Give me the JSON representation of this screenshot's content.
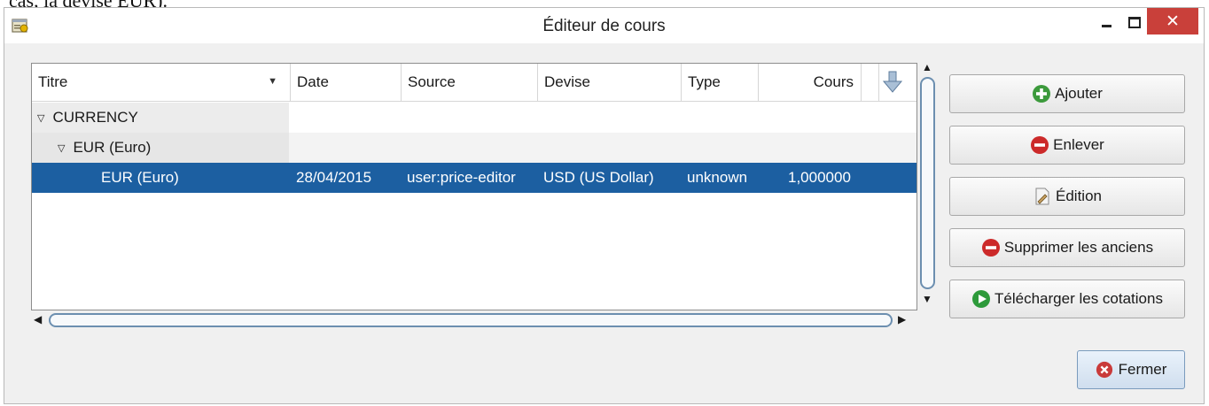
{
  "top_cut_text": "cas, la devise EUR).",
  "window": {
    "title": "Éditeur de cours"
  },
  "columns": [
    {
      "label": "Titre"
    },
    {
      "label": "Date"
    },
    {
      "label": "Source"
    },
    {
      "label": "Devise"
    },
    {
      "label": "Type"
    },
    {
      "label": "Cours"
    }
  ],
  "rows": {
    "currency_group": "CURRENCY",
    "eur_group": "EUR (Euro)",
    "selected": {
      "title": "EUR (Euro)",
      "date": "28/04/2015",
      "source": "user:price-editor",
      "currency": "USD (US Dollar)",
      "type": "unknown",
      "rate": "1,000000"
    }
  },
  "buttons": {
    "add": "Ajouter",
    "remove": "Enlever",
    "edit": "Édition",
    "delete_old": "Supprimer les anciens",
    "download": "Télécharger les cotations",
    "close": "Fermer"
  },
  "icons": {
    "add": "plus-circle-icon",
    "remove": "minus-circle-icon",
    "edit": "document-pencil-icon",
    "delete_old": "minus-circle-icon",
    "download": "play-circle-icon",
    "close": "x-circle-icon",
    "download_column": "down-arrow-icon"
  },
  "colors": {
    "selection": "#1c5fa1",
    "close_button": "#c9403a",
    "add_icon": "#3c9a3c",
    "remove_icon": "#cc2a2a",
    "download_icon": "#2d9a3a"
  }
}
